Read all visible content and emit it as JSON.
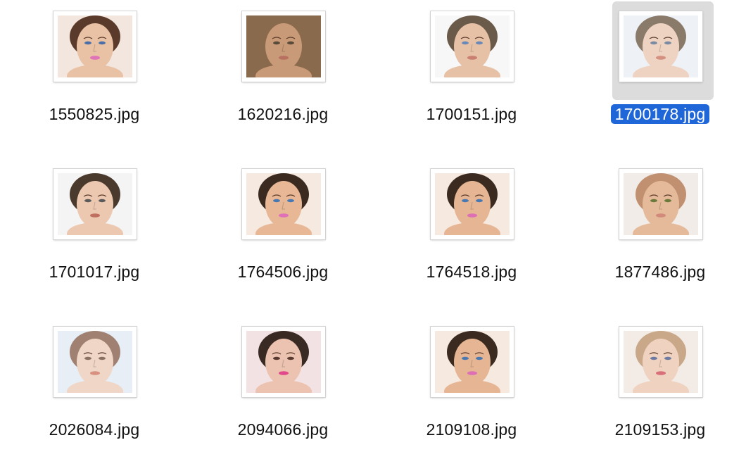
{
  "files": [
    {
      "name": "1550825.jpg",
      "selected": false,
      "bg": "#f2e6de",
      "skin": "#e9c2a5",
      "hair": "#5a3a2a",
      "lip": "#e072b8",
      "eye": "#4a6ea8"
    },
    {
      "name": "1620216.jpg",
      "selected": false,
      "bg": "#8a6a4c",
      "skin": "#c89a78",
      "hair": "#8a6a4c",
      "lip": "#b87060",
      "eye": "#5a4a3a"
    },
    {
      "name": "1700151.jpg",
      "selected": false,
      "bg": "#f7f7f7",
      "skin": "#e6c1a6",
      "hair": "#6a5a4a",
      "lip": "#c98070",
      "eye": "#6a88b8"
    },
    {
      "name": "1700178.jpg",
      "selected": true,
      "bg": "#eef2f6",
      "skin": "#efd3c2",
      "hair": "#8a7a6a",
      "lip": "#d49080",
      "eye": "#7a8aa0"
    },
    {
      "name": "1701017.jpg",
      "selected": false,
      "bg": "#f4f4f4",
      "skin": "#ecc8b1",
      "hair": "#4a3a2e",
      "lip": "#c07060",
      "eye": "#5a5a5a"
    },
    {
      "name": "1764506.jpg",
      "selected": false,
      "bg": "#f5e9e0",
      "skin": "#e7b796",
      "hair": "#3a2a20",
      "lip": "#e070b8",
      "eye": "#4a78b0"
    },
    {
      "name": "1764518.jpg",
      "selected": false,
      "bg": "#f5e9e0",
      "skin": "#e6b594",
      "hair": "#3a2a20",
      "lip": "#dd6fb4",
      "eye": "#4a78b0"
    },
    {
      "name": "1877486.jpg",
      "selected": false,
      "bg": "#f1ece8",
      "skin": "#e4ba9a",
      "hair": "#c09070",
      "lip": "#d28a7a",
      "eye": "#6a7a3a"
    },
    {
      "name": "2026084.jpg",
      "selected": false,
      "bg": "#e7eef5",
      "skin": "#f0d6c6",
      "hair": "#a08070",
      "lip": "#d89080",
      "eye": "#8a7060"
    },
    {
      "name": "2094066.jpg",
      "selected": false,
      "bg": "#f3e2e4",
      "skin": "#ebc3b0",
      "hair": "#3a2a24",
      "lip": "#e04a8a",
      "eye": "#5a3a30"
    },
    {
      "name": "2109108.jpg",
      "selected": false,
      "bg": "#f5e9e0",
      "skin": "#e6b594",
      "hair": "#3a2a20",
      "lip": "#dd6fb4",
      "eye": "#4a78b0"
    },
    {
      "name": "2109153.jpg",
      "selected": false,
      "bg": "#f3ece6",
      "skin": "#f0d2c0",
      "hair": "#c8a888",
      "lip": "#d8707a",
      "eye": "#6a7aa0"
    }
  ]
}
